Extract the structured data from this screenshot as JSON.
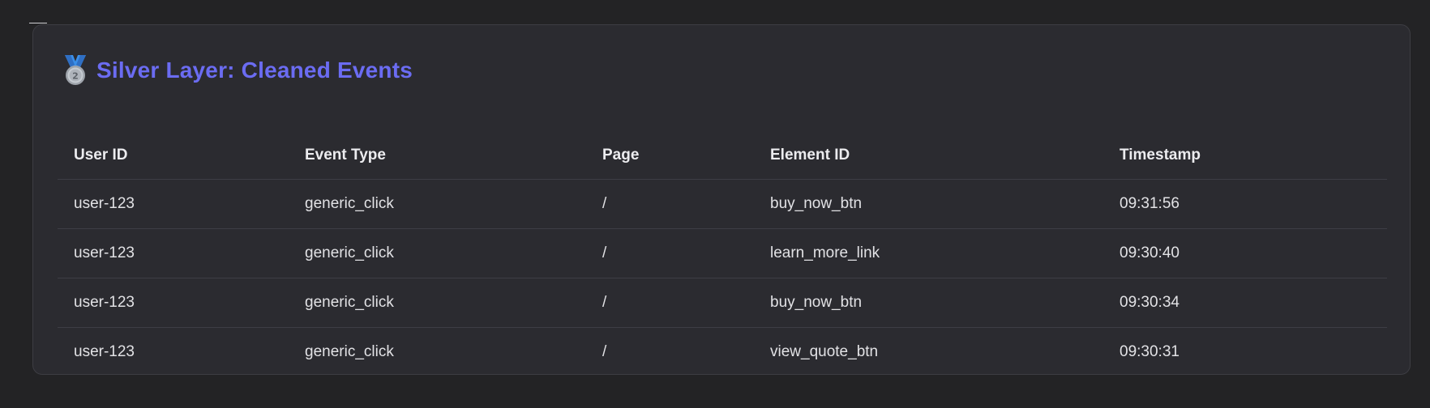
{
  "panel": {
    "title": "Silver Layer: Cleaned Events",
    "icon": "second-place-medal-icon",
    "accent_color": "#6b6cf2"
  },
  "table": {
    "columns": [
      "User ID",
      "Event Type",
      "Page",
      "Element ID",
      "Timestamp"
    ],
    "rows": [
      {
        "user_id": "user-123",
        "event_type": "generic_click",
        "page": "/",
        "element_id": "buy_now_btn",
        "timestamp": "09:31:56"
      },
      {
        "user_id": "user-123",
        "event_type": "generic_click",
        "page": "/",
        "element_id": "learn_more_link",
        "timestamp": "09:30:40"
      },
      {
        "user_id": "user-123",
        "event_type": "generic_click",
        "page": "/",
        "element_id": "buy_now_btn",
        "timestamp": "09:30:34"
      },
      {
        "user_id": "user-123",
        "event_type": "generic_click",
        "page": "/",
        "element_id": "view_quote_btn",
        "timestamp": "09:30:31"
      }
    ]
  }
}
